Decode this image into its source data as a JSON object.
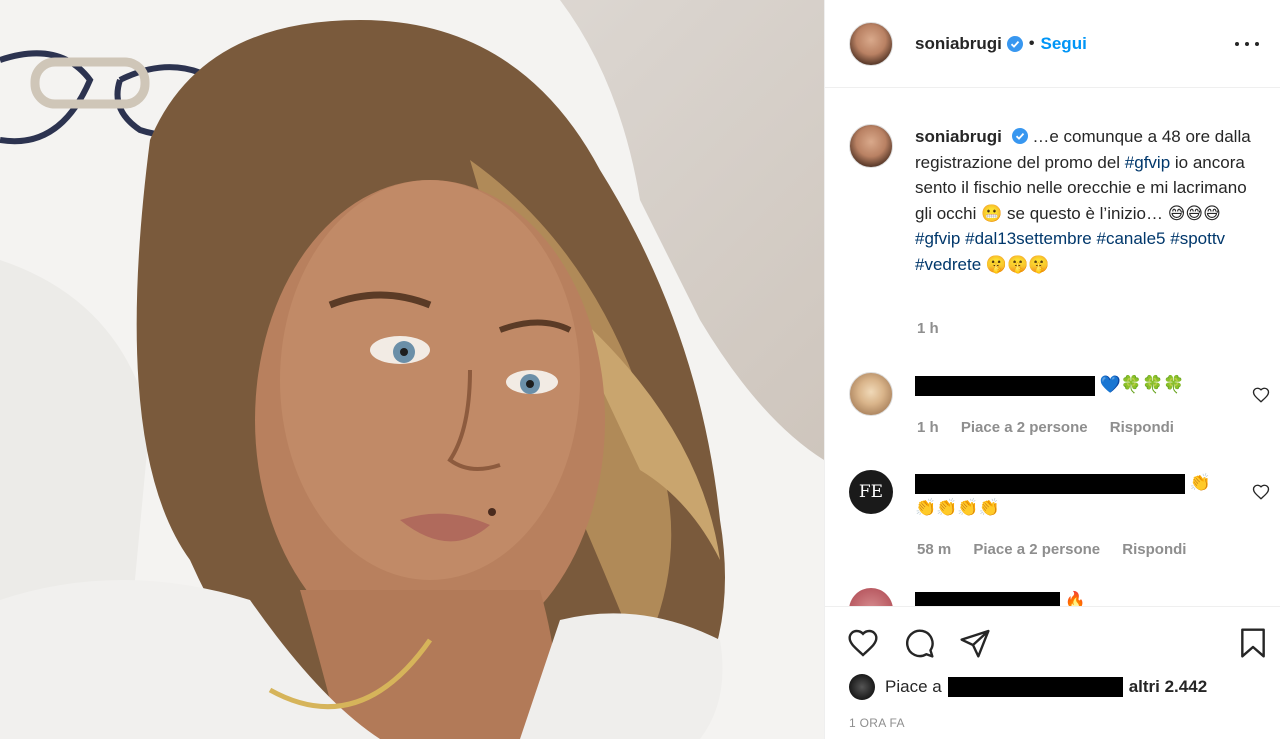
{
  "post": {
    "username": "soniabrugi",
    "follow_label": "Segui",
    "separator": "•"
  },
  "caption": {
    "username": "soniabrugi",
    "text_before_tag1": "…e comunque a 48 ore dalla registrazione del promo del ",
    "tag_gfvip": "#gfvip",
    "text_mid1": " io ancora sento il fischio nelle orecchie e mi lacrimano gli occhi ",
    "emoji_grimace": "😬",
    "text_mid2": " se questo è l’inizio… ",
    "emoji_sweat": "😅😅😅",
    "tag_gfvip2": "#gfvip",
    "tag_dal": "#dal13settembre",
    "tag_canale5": "#canale5",
    "tag_spottv": "#spottv",
    "tag_vedrete": "#vedrete",
    "emoji_hush": "🤫🤫🤫",
    "time": "1 h"
  },
  "comments": [
    {
      "emoji": "💙🍀🍀🍀",
      "time": "1 h",
      "likes": "Piace a 2 persone",
      "reply": "Rispondi",
      "avatar": "blonde-woman-avatar"
    },
    {
      "emoji_inline": "👏",
      "emoji_line2": "👏👏👏👏",
      "time": "58 m",
      "likes": "Piace a 2 persone",
      "reply": "Rispondi",
      "avatar_text": "FE"
    },
    {
      "emoji": "🔥",
      "avatar": "pink-avatar"
    }
  ],
  "actions": {
    "like_icon": "heart-icon",
    "comment_icon": "comment-icon",
    "share_icon": "send-icon",
    "save_icon": "bookmark-icon"
  },
  "likes": {
    "prefix": "Piace a",
    "suffix": "altri 2.442"
  },
  "timeago": "1 ORA FA",
  "colors": {
    "link": "#0095f6",
    "hashtag": "#00376b",
    "muted": "#8e8e8e",
    "text": "#262626",
    "verified": "#3897f0"
  }
}
